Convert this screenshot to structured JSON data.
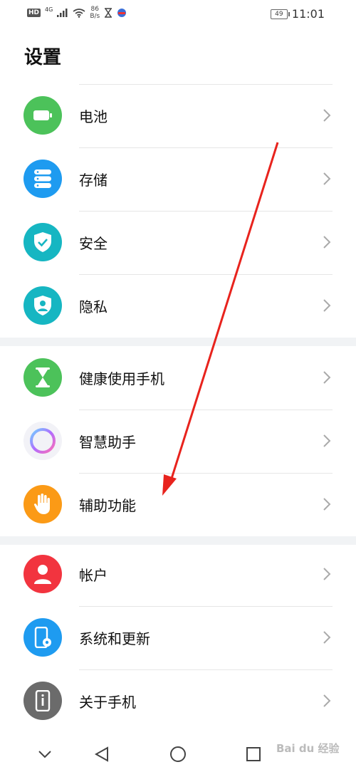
{
  "status_bar": {
    "hd": "HD",
    "network": "4G",
    "speed_value": "86",
    "speed_unit": "B/s",
    "battery": "49",
    "time": "11:01"
  },
  "page": {
    "title": "设置"
  },
  "settings": {
    "group1": [
      {
        "label": "电池",
        "icon": "battery-icon",
        "color": "#4cc25a"
      },
      {
        "label": "存储",
        "icon": "storage-icon",
        "color": "#1e9bf0"
      },
      {
        "label": "安全",
        "icon": "shield-check-icon",
        "color": "#16b6c2"
      },
      {
        "label": "隐私",
        "icon": "privacy-shield-icon",
        "color": "#16b6c2"
      }
    ],
    "group2": [
      {
        "label": "健康使用手机",
        "icon": "hourglass-icon",
        "color": "#4cc25a"
      },
      {
        "label": "智慧助手",
        "icon": "assistant-ring-icon",
        "color": "#f2f2f7"
      },
      {
        "label": "辅助功能",
        "icon": "hand-icon",
        "color": "#fb9a16"
      }
    ],
    "group3": [
      {
        "label": "帐户",
        "icon": "person-icon",
        "color": "#f2343f"
      },
      {
        "label": "系统和更新",
        "icon": "phone-gear-icon",
        "color": "#1e9bf0"
      },
      {
        "label": "关于手机",
        "icon": "phone-info-icon",
        "color": "#6b6b6b"
      }
    ]
  },
  "navigation": {
    "collapse": "chevron-down-icon",
    "back": "back-triangle-icon",
    "home": "home-circle-icon",
    "recents": "recents-square-icon"
  },
  "watermark": {
    "text": "Bai du 经验"
  },
  "colors": {
    "accent_arrow": "#e8231d",
    "group_gap": "#f1f3f5",
    "divider": "#e6e6e6"
  }
}
